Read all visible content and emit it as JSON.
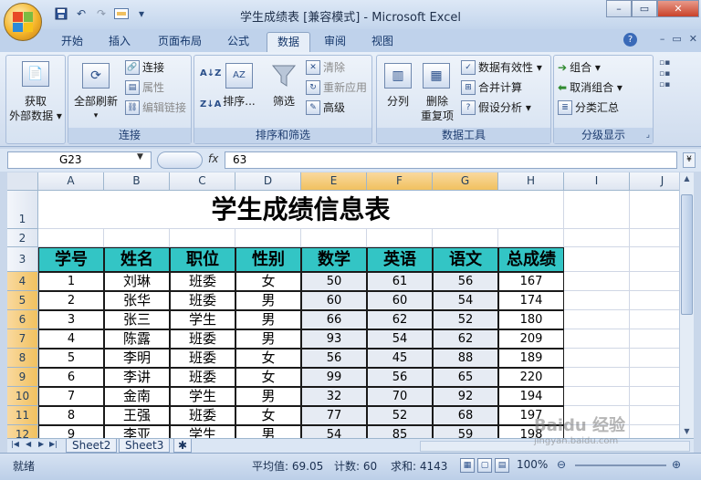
{
  "window": {
    "title": "学生成绩表  [兼容模式] - Microsoft Excel",
    "controls": {
      "minimize": "–",
      "restore": "▭",
      "close": "✕"
    }
  },
  "qat": {
    "save_icon": "save-icon",
    "undo": "↶",
    "redo": "↷",
    "customize": "▾"
  },
  "tabs": [
    {
      "label": "开始"
    },
    {
      "label": "插入"
    },
    {
      "label": "页面布局"
    },
    {
      "label": "公式"
    },
    {
      "label": "数据",
      "active": true
    },
    {
      "label": "审阅"
    },
    {
      "label": "视图"
    }
  ],
  "ribbon": {
    "groups": {
      "external": {
        "get_data": "获取",
        "get_data2": "外部数据 ▾"
      },
      "connections": {
        "label": "连接",
        "refresh_all": "全部刷新",
        "refresh_arrow": "▾",
        "connections": "连接",
        "properties": "属性",
        "edit_links": "编辑链接"
      },
      "sort_filter": {
        "label": "排序和筛选",
        "sort": "排序...",
        "filter": "筛选",
        "clear": "清除",
        "reapply": "重新应用",
        "advanced": "高级"
      },
      "data_tools": {
        "label": "数据工具",
        "split": "分列",
        "remove_dup1": "删除",
        "remove_dup2": "重复项",
        "validation": "数据有效性 ▾",
        "consolidate": "合并计算",
        "whatif": "假设分析 ▾"
      },
      "outline": {
        "label": "分级显示",
        "group": "组合 ▾",
        "ungroup": "取消组合 ▾",
        "subtotal": "分类汇总"
      }
    }
  },
  "formula_bar": {
    "name_box": "G23",
    "fx": "fx",
    "value": "63"
  },
  "columns": [
    "A",
    "B",
    "C",
    "D",
    "E",
    "F",
    "G",
    "H",
    "I",
    "J"
  ],
  "rows": [
    "1",
    "2",
    "3",
    "4",
    "5",
    "6",
    "7",
    "8",
    "9",
    "10",
    "11",
    "12"
  ],
  "sheet": {
    "title": "学生成绩信息表",
    "headers": [
      "学号",
      "姓名",
      "职位",
      "性别",
      "数学",
      "英语",
      "语文",
      "总成绩"
    ],
    "data": [
      [
        "1",
        "刘琳",
        "班委",
        "女",
        "50",
        "61",
        "56",
        "167"
      ],
      [
        "2",
        "张华",
        "班委",
        "男",
        "60",
        "60",
        "54",
        "174"
      ],
      [
        "3",
        "张三",
        "学生",
        "男",
        "66",
        "62",
        "52",
        "180"
      ],
      [
        "4",
        "陈露",
        "班委",
        "男",
        "93",
        "54",
        "62",
        "209"
      ],
      [
        "5",
        "李明",
        "班委",
        "女",
        "56",
        "45",
        "88",
        "189"
      ],
      [
        "6",
        "李讲",
        "班委",
        "女",
        "99",
        "56",
        "65",
        "220"
      ],
      [
        "7",
        "金南",
        "学生",
        "男",
        "32",
        "70",
        "92",
        "194"
      ],
      [
        "8",
        "王强",
        "班委",
        "女",
        "77",
        "52",
        "68",
        "197"
      ],
      [
        "9",
        "李亚",
        "学生",
        "男",
        "54",
        "85",
        "59",
        "198"
      ]
    ]
  },
  "sheet_tabs": [
    "Sheet2",
    "Sheet3"
  ],
  "status": {
    "mode": "就绪",
    "average": "平均值: 69.05",
    "count": "计数: 60",
    "sum": "求和: 4143",
    "zoom": "100%"
  },
  "watermark": "Baidu 经验",
  "watermark2": "jingyan.baidu.com",
  "colors": {
    "header_fill": "#33c5c5",
    "selected_header": "#f1c15f",
    "ribbon": "#dce7f5"
  }
}
